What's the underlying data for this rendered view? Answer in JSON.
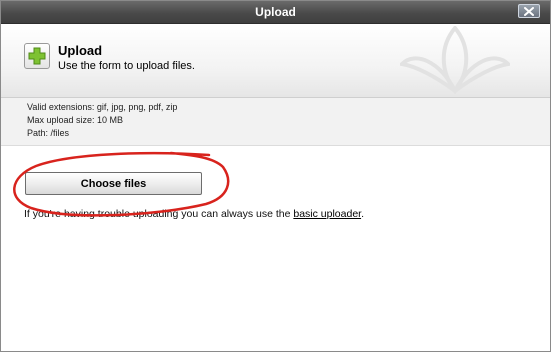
{
  "window": {
    "title": "Upload",
    "close_icon": "close-x-icon"
  },
  "header": {
    "icon": "green-plus-icon",
    "title": "Upload",
    "subtitle": "Use the form to upload files."
  },
  "info": {
    "extensions": "Valid extensions: gif, jpg, png, pdf, zip",
    "max_size": "Max upload size: 10 MB",
    "path": "Path: /files"
  },
  "main": {
    "choose_files_label": "Choose files",
    "note_prefix": "If you're having trouble uploading you can always use the ",
    "note_link": "basic uploader",
    "note_suffix": "."
  },
  "colors": {
    "titlebar": "#4a4a4a",
    "plus_icon": "#7ec232",
    "annotation": "#d8231d"
  }
}
